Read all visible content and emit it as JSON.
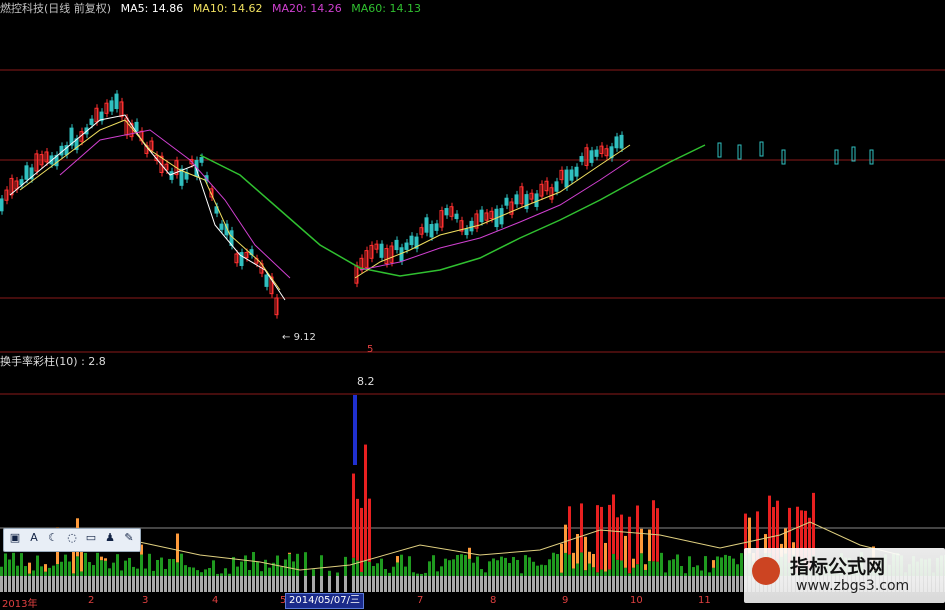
{
  "header": {
    "title": "燃控科技(日线 前复权)",
    "ma5": "MA5: 14.86",
    "ma10": "MA10: 14.62",
    "ma20": "MA20: 14.26",
    "ma60": "MA60: 14.13"
  },
  "colors": {
    "title": "#c0c0c0",
    "ma5": "#ffffff",
    "ma10": "#f0e060",
    "ma20": "#d040d0",
    "ma60": "#30c030",
    "up": "#ff3030",
    "down": "#30c0c0",
    "grid": "#8a1a1a"
  },
  "indicator": {
    "label": "换手率彩柱(10)",
    "value": ": 2.8",
    "peak_label": "8.2"
  },
  "low_label": "9.12",
  "axis": {
    "year_label": "2013年",
    "months": [
      "2",
      "3",
      "4",
      "5",
      "7",
      "8",
      "9",
      "10",
      "11"
    ],
    "cursor_date": "2014/05/07/三",
    "marker": "5"
  },
  "toolbar": {
    "icons": [
      "screenshot-icon",
      "text-icon",
      "moon-icon",
      "chat-icon",
      "keyboard-icon",
      "user-icon",
      "settings-icon"
    ]
  },
  "watermark": {
    "cn": "指标公式网",
    "url": "www.zbgs3.com"
  }
}
